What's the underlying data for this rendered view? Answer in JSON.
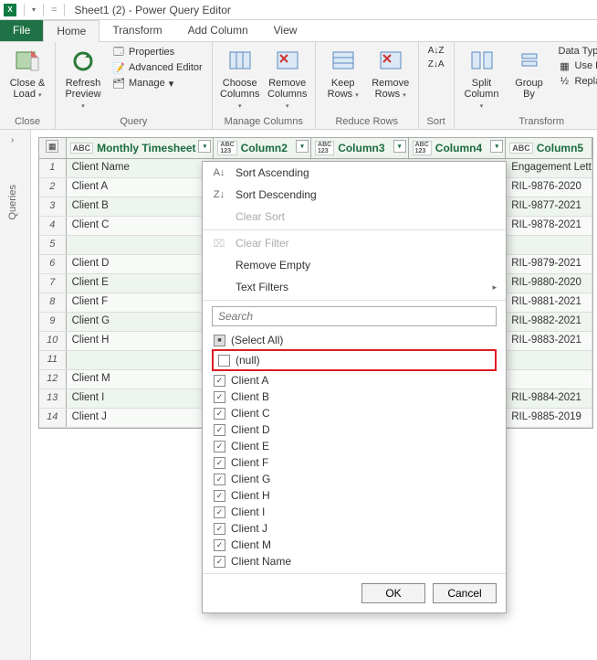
{
  "title": "Sheet1 (2) - Power Query Editor",
  "tabs": {
    "file": "File",
    "home": "Home",
    "transform": "Transform",
    "addcol": "Add Column",
    "view": "View"
  },
  "ribbon": {
    "close": {
      "label1": "Close &",
      "label2": "Load",
      "group": "Close"
    },
    "refresh": {
      "label1": "Refresh",
      "label2": "Preview",
      "props": "Properties",
      "adv": "Advanced Editor",
      "manage": "Manage",
      "group": "Query"
    },
    "choose": {
      "label1": "Choose",
      "label2": "Columns"
    },
    "remove": {
      "label1": "Remove",
      "label2": "Columns"
    },
    "managecols": "Manage Columns",
    "keep": {
      "label1": "Keep",
      "label2": "Rows"
    },
    "removerows": {
      "label1": "Remove",
      "label2": "Rows"
    },
    "reducerows": "Reduce Rows",
    "sort": "Sort",
    "split": {
      "label1": "Split",
      "label2": "Column"
    },
    "groupby": {
      "label1": "Group",
      "label2": "By"
    },
    "datatype": "Data Type: Te",
    "usefirst": "Use First",
    "replace": "Replace",
    "transform": "Transform"
  },
  "queries_label": "Queries",
  "columns": {
    "c1_type": "ABC",
    "c1": "Monthly Timesheet",
    "c2_type": "ABC\n123",
    "c2": "Column2",
    "c3_type": "ABC\n123",
    "c3": "Column3",
    "c4_type": "ABC\n123",
    "c4": "Column4",
    "c5_type": "ABC",
    "c5": "Column5"
  },
  "rows": [
    {
      "n": "1",
      "c1": "Client Name",
      "c5": "Engagement Letter"
    },
    {
      "n": "2",
      "c1": "Client A",
      "c5": "RIL-9876-2020"
    },
    {
      "n": "3",
      "c1": "Client B",
      "c5": "RIL-9877-2021"
    },
    {
      "n": "4",
      "c1": "Client C",
      "c5": "RIL-9878-2021"
    },
    {
      "n": "5",
      "c1": "",
      "c5": ""
    },
    {
      "n": "6",
      "c1": "Client D",
      "c5": "RIL-9879-2021"
    },
    {
      "n": "7",
      "c1": "Client E",
      "c5": "RIL-9880-2020"
    },
    {
      "n": "8",
      "c1": "Client F",
      "c5": "RIL-9881-2021"
    },
    {
      "n": "9",
      "c1": "Client G",
      "c5": "RIL-9882-2021"
    },
    {
      "n": "10",
      "c1": "Client H",
      "c5": "RIL-9883-2021"
    },
    {
      "n": "11",
      "c1": "",
      "c5": ""
    },
    {
      "n": "12",
      "c1": "Client M",
      "c5": ""
    },
    {
      "n": "13",
      "c1": "Client I",
      "c5": "RIL-9884-2021"
    },
    {
      "n": "14",
      "c1": "Client J",
      "c5": "RIL-9885-2019"
    }
  ],
  "filter": {
    "sort_asc": "Sort Ascending",
    "sort_desc": "Sort Descending",
    "clear_sort": "Clear Sort",
    "clear_filter": "Clear Filter",
    "remove_empty": "Remove Empty",
    "text_filters": "Text Filters",
    "search_placeholder": "Search",
    "select_all": "(Select All)",
    "null_item": "(null)",
    "items": [
      "Client A",
      "Client B",
      "Client C",
      "Client D",
      "Client E",
      "Client F",
      "Client G",
      "Client H",
      "Client I",
      "Client J",
      "Client M",
      "Client Name"
    ],
    "ok": "OK",
    "cancel": "Cancel"
  }
}
